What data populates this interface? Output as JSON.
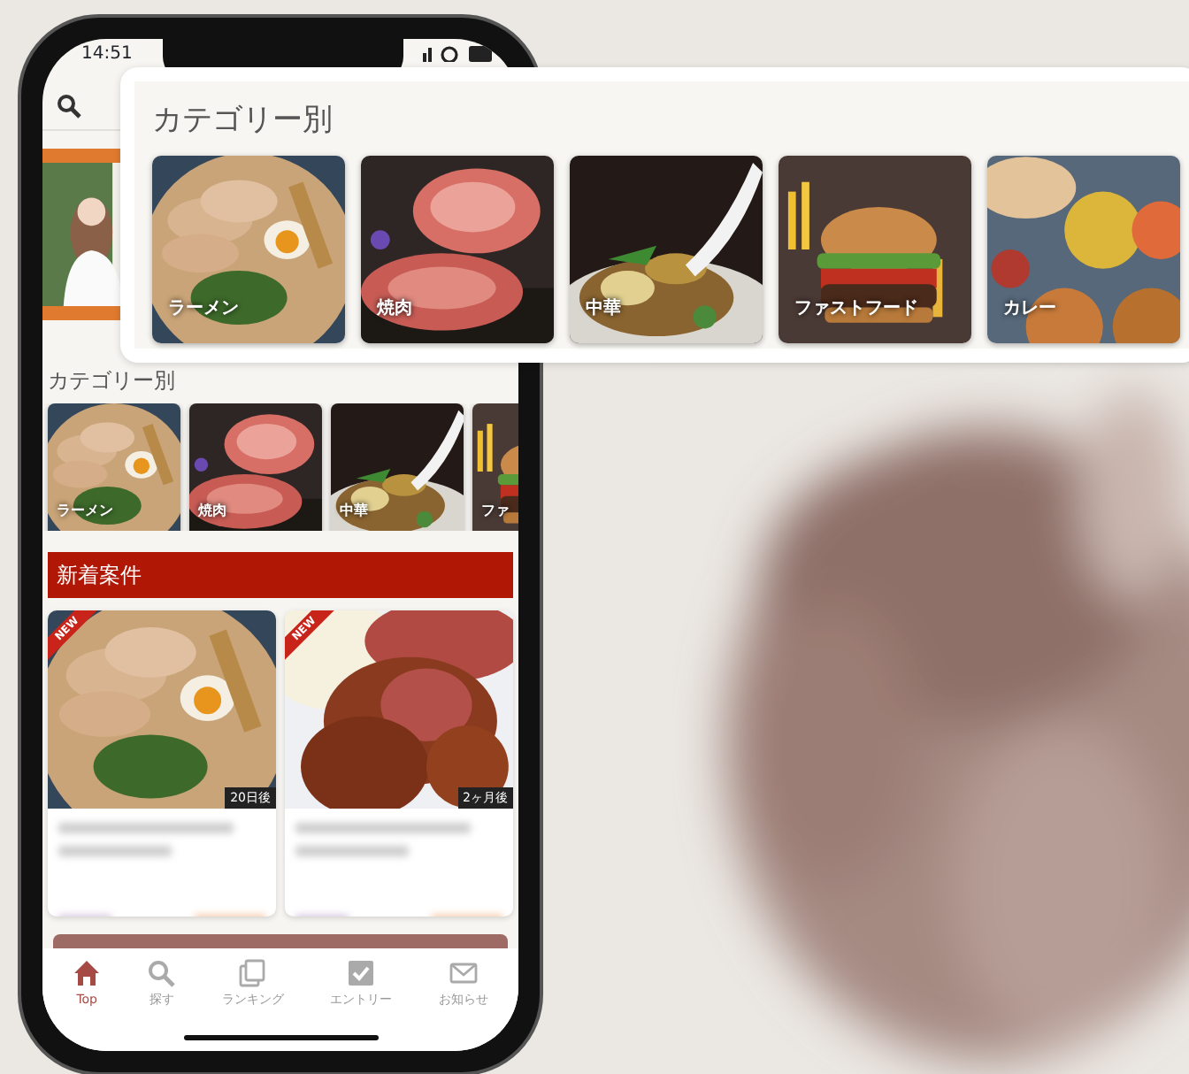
{
  "phone": {
    "status_bar": {
      "time": "14:51"
    },
    "category_section": {
      "title": "カテゴリー別",
      "categories": [
        {
          "label": "ラーメン"
        },
        {
          "label": "焼肉"
        },
        {
          "label": "中華"
        },
        {
          "label": "ファ"
        }
      ]
    },
    "new_listings": {
      "title": "新着案件",
      "items": [
        {
          "badge": "NEW",
          "time": "20日後"
        },
        {
          "badge": "NEW",
          "time": "2ヶ月後"
        }
      ]
    },
    "tab_bar": [
      {
        "label": "Top",
        "selected": true
      },
      {
        "label": "探す",
        "selected": false
      },
      {
        "label": "ランキング",
        "selected": false
      },
      {
        "label": "エントリー",
        "selected": false
      },
      {
        "label": "お知らせ",
        "selected": false
      }
    ]
  },
  "callout": {
    "title": "カテゴリー別",
    "categories": [
      {
        "label": "ラーメン"
      },
      {
        "label": "焼肉"
      },
      {
        "label": "中華"
      },
      {
        "label": "ファストフード"
      },
      {
        "label": "カレー"
      }
    ]
  }
}
